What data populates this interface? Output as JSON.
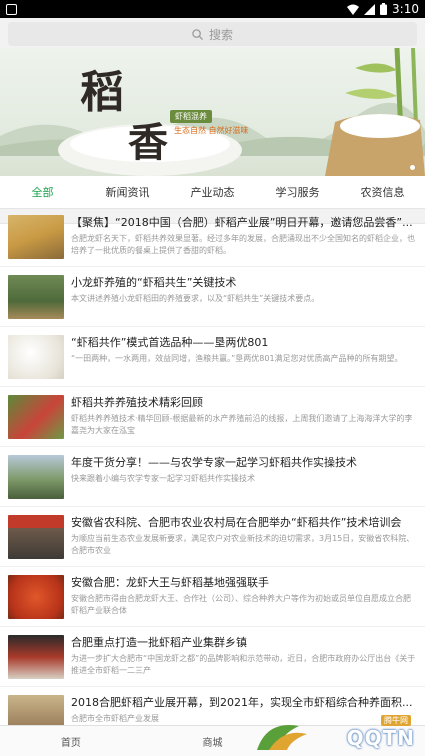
{
  "status": {
    "time": "3:10"
  },
  "search": {
    "placeholder": "搜索"
  },
  "banner": {
    "char1": "稻",
    "char2": "香",
    "tag": "虾稻混养",
    "slogan": "生态自然 自然好滋味"
  },
  "tabs": [
    {
      "label": "全部",
      "active": true
    },
    {
      "label": "新闻资讯"
    },
    {
      "label": "产业动态"
    },
    {
      "label": "学习服务"
    },
    {
      "label": "农资信息"
    }
  ],
  "articles": [
    {
      "title": "【聚焦】“2018中国（合肥）虾稻产业展”明日开幕，邀请您品尝香”...",
      "desc": "合肥龙虾名天下，虾稻共养效果显著。经过多年的发展，合肥涌现出不少全国知名的虾稻企业，也培养了一批优质的餐桌上提供了香甜的虾稻。"
    },
    {
      "title": "小龙虾养殖的“虾稻共生”关键技术",
      "desc": "本文讲述养殖小龙虾稻田的养殖要求，以及“虾稻共生”关键技术要点。"
    },
    {
      "title": "“虾稻共作”模式首选品种——垦两优801",
      "desc": "“一田两种，一水两用，效益同增，渔粮共赢。”垦两优801满足您对优质高产品种的所有期望。"
    },
    {
      "title": "虾稻共养养殖技术精彩回顾",
      "desc": "虾稻共养养殖技术·精华回顾-根据最新的水产养殖前沿的线报，上周我们邀请了上海海洋大学的李嘉尧为大家在泓宝"
    },
    {
      "title": "年度干货分享！——与农学专家一起学习虾稻共作实操技术",
      "desc": "快来跟着小编与农学专家一起学习虾稻共作实操技术"
    },
    {
      "title": "安徽省农科院、合肥市农业农村局在合肥举办“虾稻共作”技术培训会",
      "desc": "为顺应当前生态农业发展新要求，满足农户对农业新技术的迫切需求，3月15日，安徽省农科院、合肥市农业"
    },
    {
      "title": "安徽合肥：龙虾大王与虾稻基地强强联手",
      "desc": "安徽合肥市得由合肥龙虾大王、合作社（公司）、综合种养大户等作为初始或员单位自愿成立合肥虾稻产业联合体"
    },
    {
      "title": "合肥重点打造一批虾稻产业集群乡镇",
      "desc": "为进一步扩大合肥市“中国龙虾之都”的品牌影响和示范带动，近日，合肥市政府办公厅出台《关于推进全市虾稻一二三产"
    },
    {
      "title": "2018合肥虾稻产业展开幕，到2021年，实现全市虾稻综合种养面积...",
      "desc": "合肥市全市虾稻产业发展"
    }
  ],
  "bottom_nav": {
    "home": "首页",
    "mall": "商城",
    "watermark": "QQTN",
    "watermark_site": "腾牛网"
  }
}
